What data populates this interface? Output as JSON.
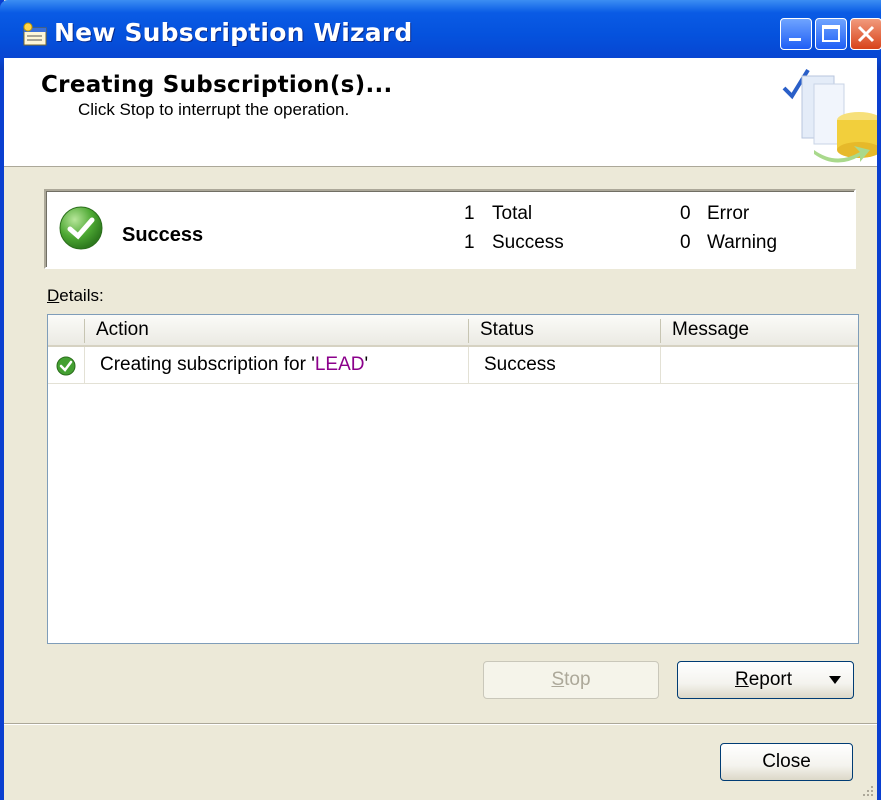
{
  "window": {
    "title": "New Subscription Wizard"
  },
  "header": {
    "title": "Creating Subscription(s)...",
    "subtitle": "Click Stop to interrupt the operation."
  },
  "summary": {
    "status": "Success",
    "total_count": "1",
    "total_label": "Total",
    "success_count": "1",
    "success_label": "Success",
    "error_count": "0",
    "error_label": "Error",
    "warning_count": "0",
    "warning_label": "Warning"
  },
  "details": {
    "label_underlined": "D",
    "label_rest": "etails:",
    "columns": [
      "Action",
      "Status",
      "Message"
    ],
    "rows": [
      {
        "icon": "success-check-icon",
        "action_prefix": "Creating subscription for '",
        "action_highlight": "LEAD",
        "action_suffix": "'",
        "status": "Success",
        "message": ""
      }
    ]
  },
  "buttons": {
    "stop_underlined": "S",
    "stop_rest": "top",
    "report_underlined": "R",
    "report_rest": "eport",
    "close": "Close"
  },
  "colors": {
    "titlebar": "#0552dd",
    "success_green": "#3f9c2c",
    "highlight": "#8b008b"
  }
}
